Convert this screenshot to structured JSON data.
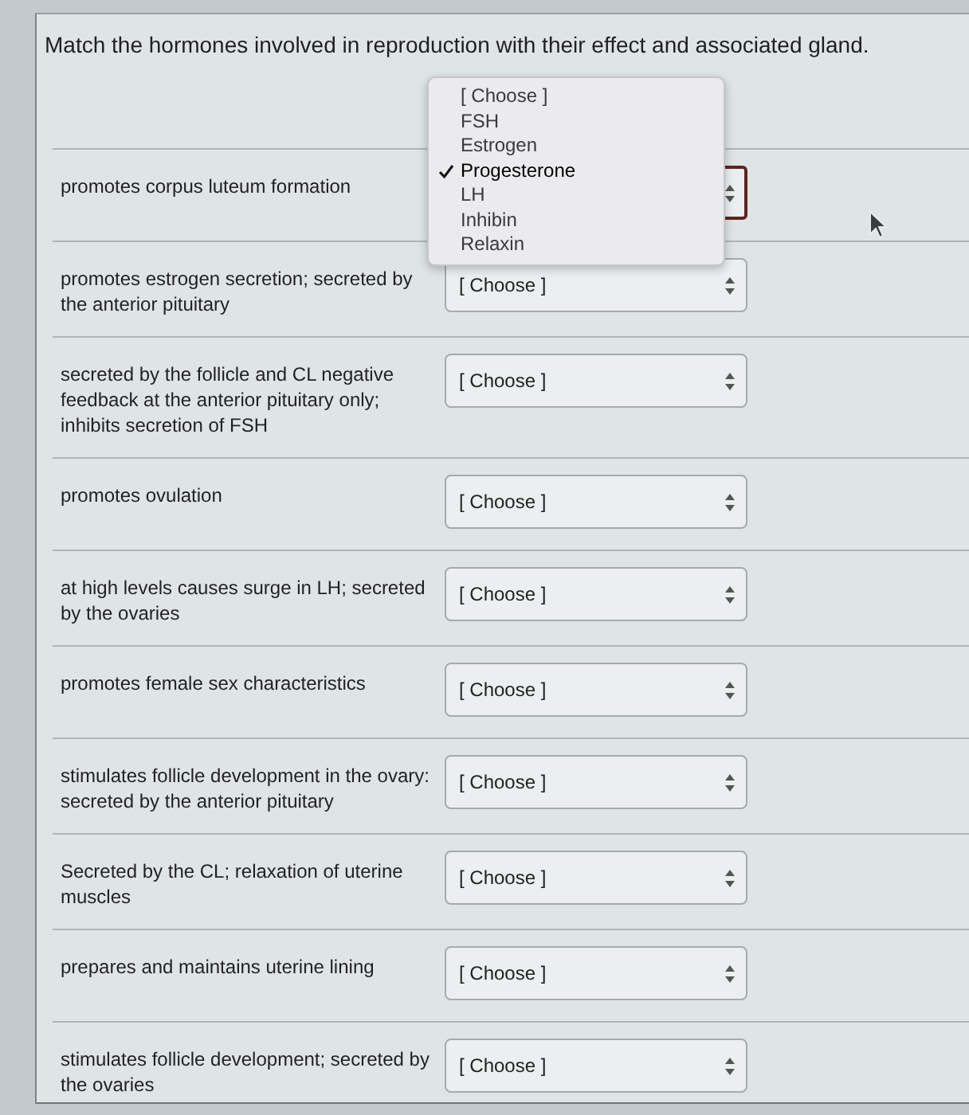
{
  "question": {
    "title": "Match the hormones involved in reproduction with their effect and associated gland.",
    "rows": [
      {
        "prompt": "promotes corpus luteum formation",
        "select": {
          "focused": true,
          "options": [
            {
              "label": "[ Choose ]",
              "selected": false
            },
            {
              "label": "FSH",
              "selected": false
            },
            {
              "label": "Estrogen",
              "selected": false
            },
            {
              "label": "Progesterone",
              "selected": true
            },
            {
              "label": "LH",
              "selected": false
            },
            {
              "label": "Inhibin",
              "selected": false
            },
            {
              "label": "Relaxin",
              "selected": false
            }
          ]
        }
      },
      {
        "prompt": "promotes estrogen secretion; secreted by the anterior pituitary",
        "select": {
          "focused": false,
          "value": "[ Choose ]"
        }
      },
      {
        "prompt": "secreted by the follicle and CL negative feedback at the anterior pituitary only; inhibits secretion of FSH",
        "select": {
          "focused": false,
          "value": "[ Choose ]"
        }
      },
      {
        "prompt": "promotes ovulation",
        "select": {
          "focused": false,
          "value": "[ Choose ]"
        }
      },
      {
        "prompt": "at high levels causes surge in LH; secreted by the ovaries",
        "select": {
          "focused": false,
          "value": "[ Choose ]"
        }
      },
      {
        "prompt": "promotes female sex characteristics",
        "select": {
          "focused": false,
          "value": "[ Choose ]"
        }
      },
      {
        "prompt": "stimulates follicle development in the ovary: secreted by the anterior pituitary",
        "select": {
          "focused": false,
          "value": "[ Choose ]"
        }
      },
      {
        "prompt": "Secreted by the CL; relaxation of uterine muscles",
        "select": {
          "focused": false,
          "value": "[ Choose ]"
        }
      },
      {
        "prompt": "prepares and maintains uterine lining",
        "select": {
          "focused": false,
          "value": "[ Choose ]"
        }
      },
      {
        "prompt": "stimulates follicle development; secreted by the ovaries",
        "select": {
          "focused": false,
          "value": "[ Choose ]"
        }
      }
    ]
  }
}
